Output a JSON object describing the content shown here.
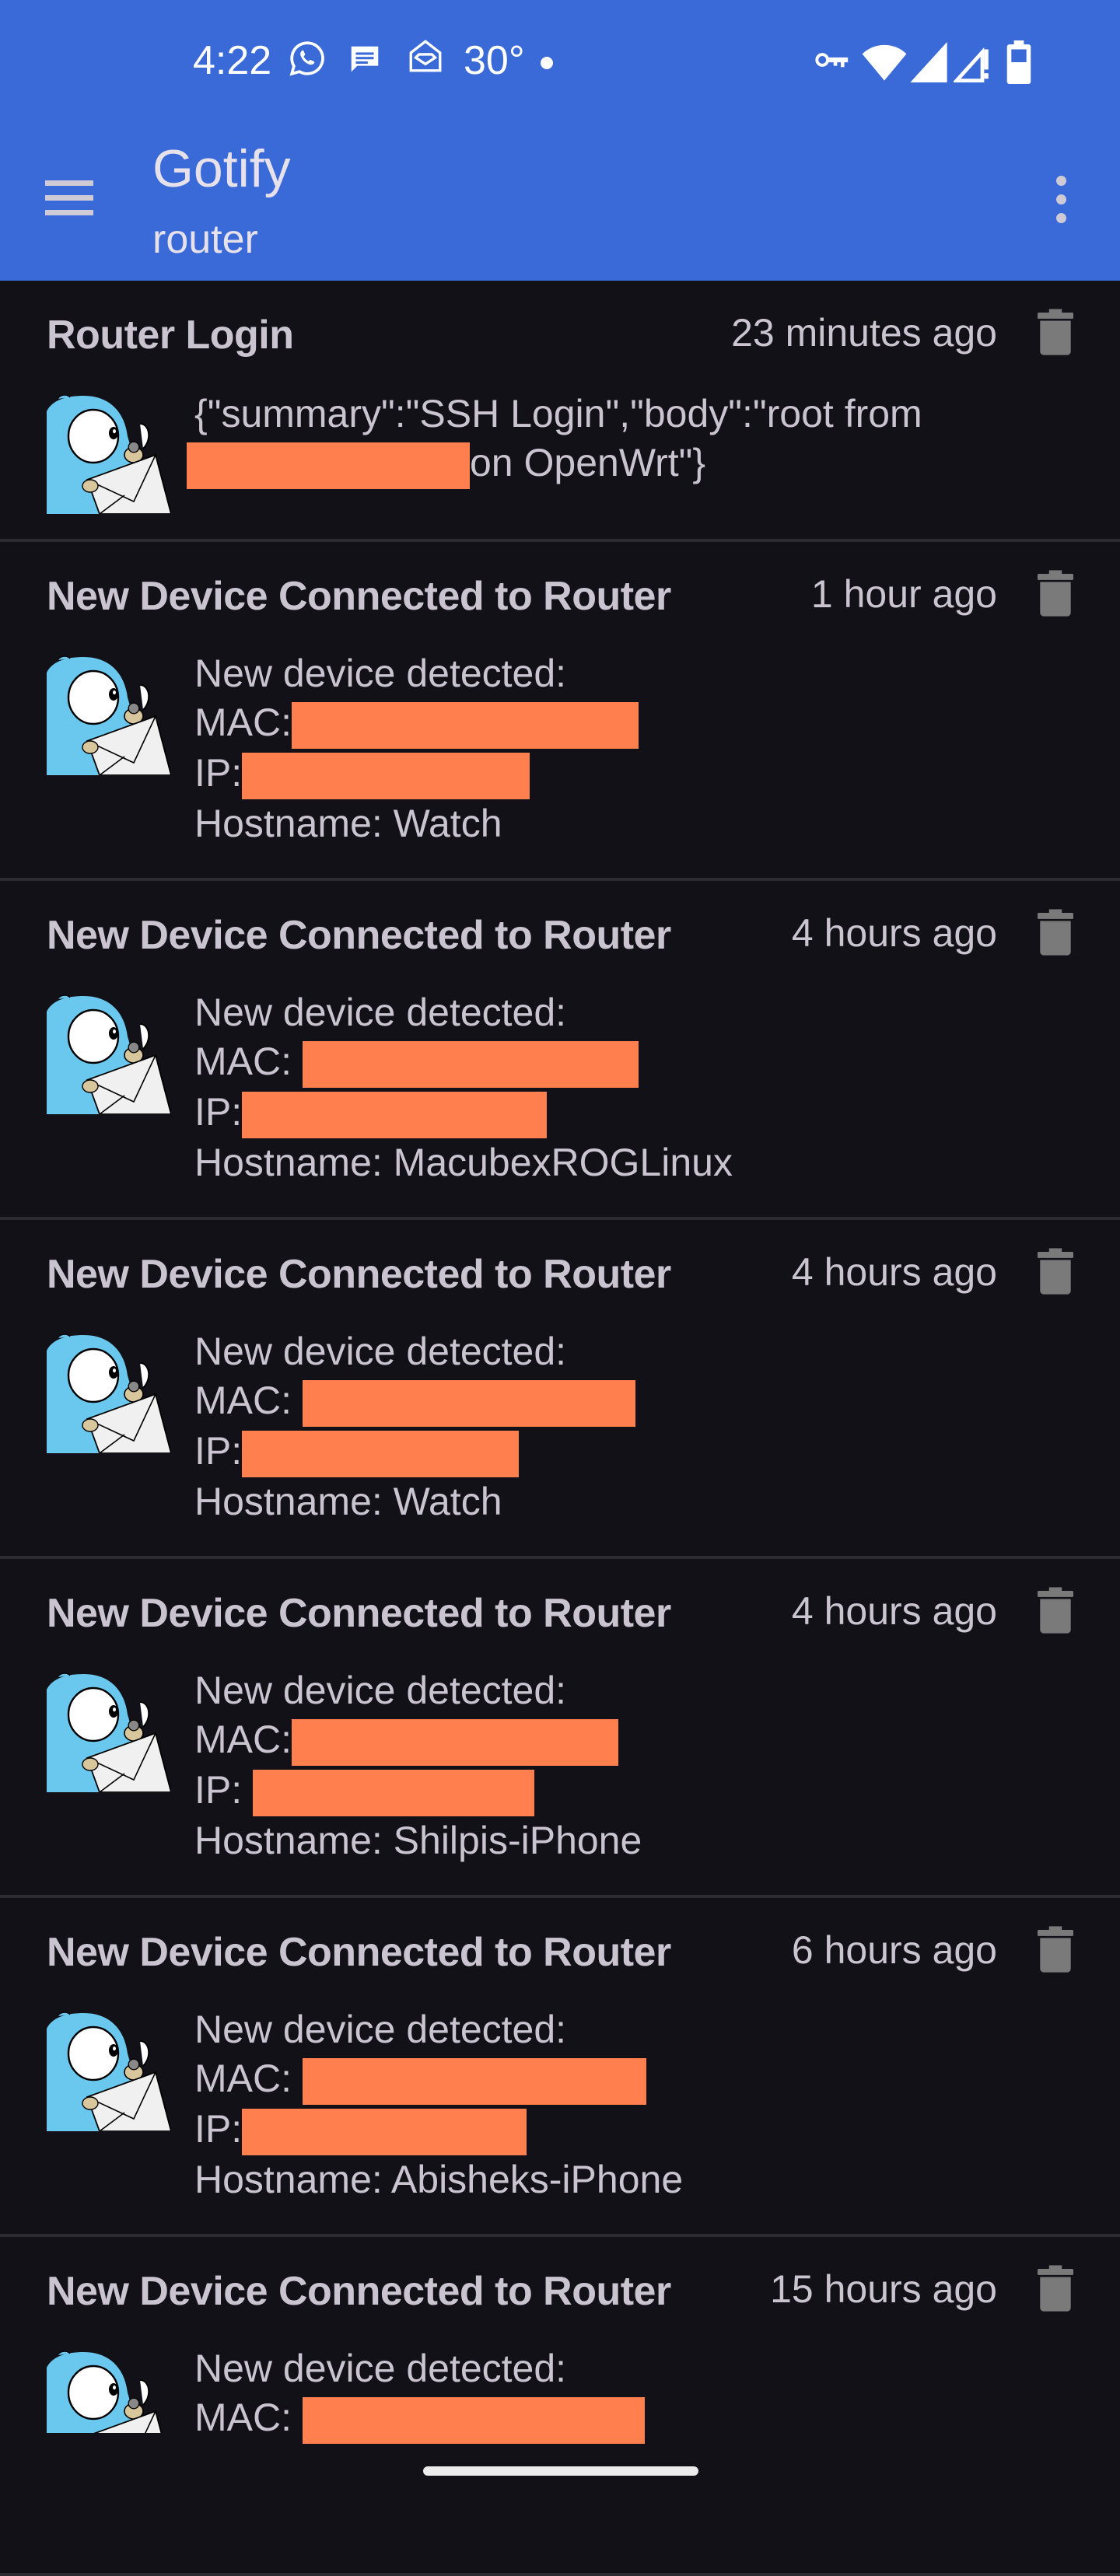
{
  "status_bar": {
    "time": "4:22",
    "temperature": "30°",
    "left_icons": [
      "whatsapp-icon",
      "message-icon",
      "mail-open-icon"
    ],
    "right_icons": [
      "vpn-key-icon",
      "wifi-icon",
      "signal-icon",
      "signal-alert-icon",
      "battery-icon"
    ]
  },
  "app_bar": {
    "title": "Gotify",
    "subtitle": "router",
    "menu_icon": "hamburger-menu-icon",
    "more_icon": "more-vert-icon"
  },
  "colors": {
    "app_bar": "#3a6ad8",
    "background": "#131118",
    "text": "#cac4d0",
    "divider": "#2d2b32",
    "redaction": "#ff7f4f",
    "trash": "#7a7a7a"
  },
  "messages": [
    {
      "title": "Router Login",
      "time": "23 minutes ago",
      "lines": [
        {
          "text": "{\"summary\":\"SSH Login\",\"body\":\"root from"
        },
        {
          "prefix": "",
          "redacted": true,
          "suffix": "on OpenWrt\"}"
        }
      ]
    },
    {
      "title": "New Device Connected to Router",
      "time": "1 hour ago",
      "lines": [
        {
          "text": "New device detected:"
        },
        {
          "prefix": "MAC:",
          "redacted": true
        },
        {
          "prefix": "IP:",
          "redacted": true
        },
        {
          "text": "Hostname: Watch"
        }
      ]
    },
    {
      "title": "New Device Connected to Router",
      "time": "4 hours ago",
      "lines": [
        {
          "text": "New device detected:"
        },
        {
          "prefix": "MAC: ",
          "redacted": true
        },
        {
          "prefix": "IP:",
          "redacted": true
        },
        {
          "text": "Hostname: MacubexROGLinux"
        }
      ]
    },
    {
      "title": "New Device Connected to Router",
      "time": "4 hours ago",
      "lines": [
        {
          "text": "New device detected:"
        },
        {
          "prefix": "MAC: ",
          "redacted": true
        },
        {
          "prefix": "IP:",
          "redacted": true
        },
        {
          "text": "Hostname: Watch"
        }
      ]
    },
    {
      "title": "New Device Connected to Router",
      "time": "4 hours ago",
      "lines": [
        {
          "text": "New device detected:"
        },
        {
          "prefix": "MAC:",
          "redacted": true
        },
        {
          "prefix": "IP: ",
          "redacted": true
        },
        {
          "text": "Hostname: Shilpis-iPhone"
        }
      ]
    },
    {
      "title": "New Device Connected to Router",
      "time": "6 hours ago",
      "lines": [
        {
          "text": "New device detected:"
        },
        {
          "prefix": "MAC: ",
          "redacted": true
        },
        {
          "prefix": "IP:",
          "redacted": true
        },
        {
          "text": "Hostname: Abisheks-iPhone"
        }
      ]
    },
    {
      "title": "New Device Connected to Router",
      "time": "15 hours ago",
      "lines": [
        {
          "text": "New device detected:"
        },
        {
          "prefix": "MAC: ",
          "redacted": true
        }
      ]
    }
  ]
}
